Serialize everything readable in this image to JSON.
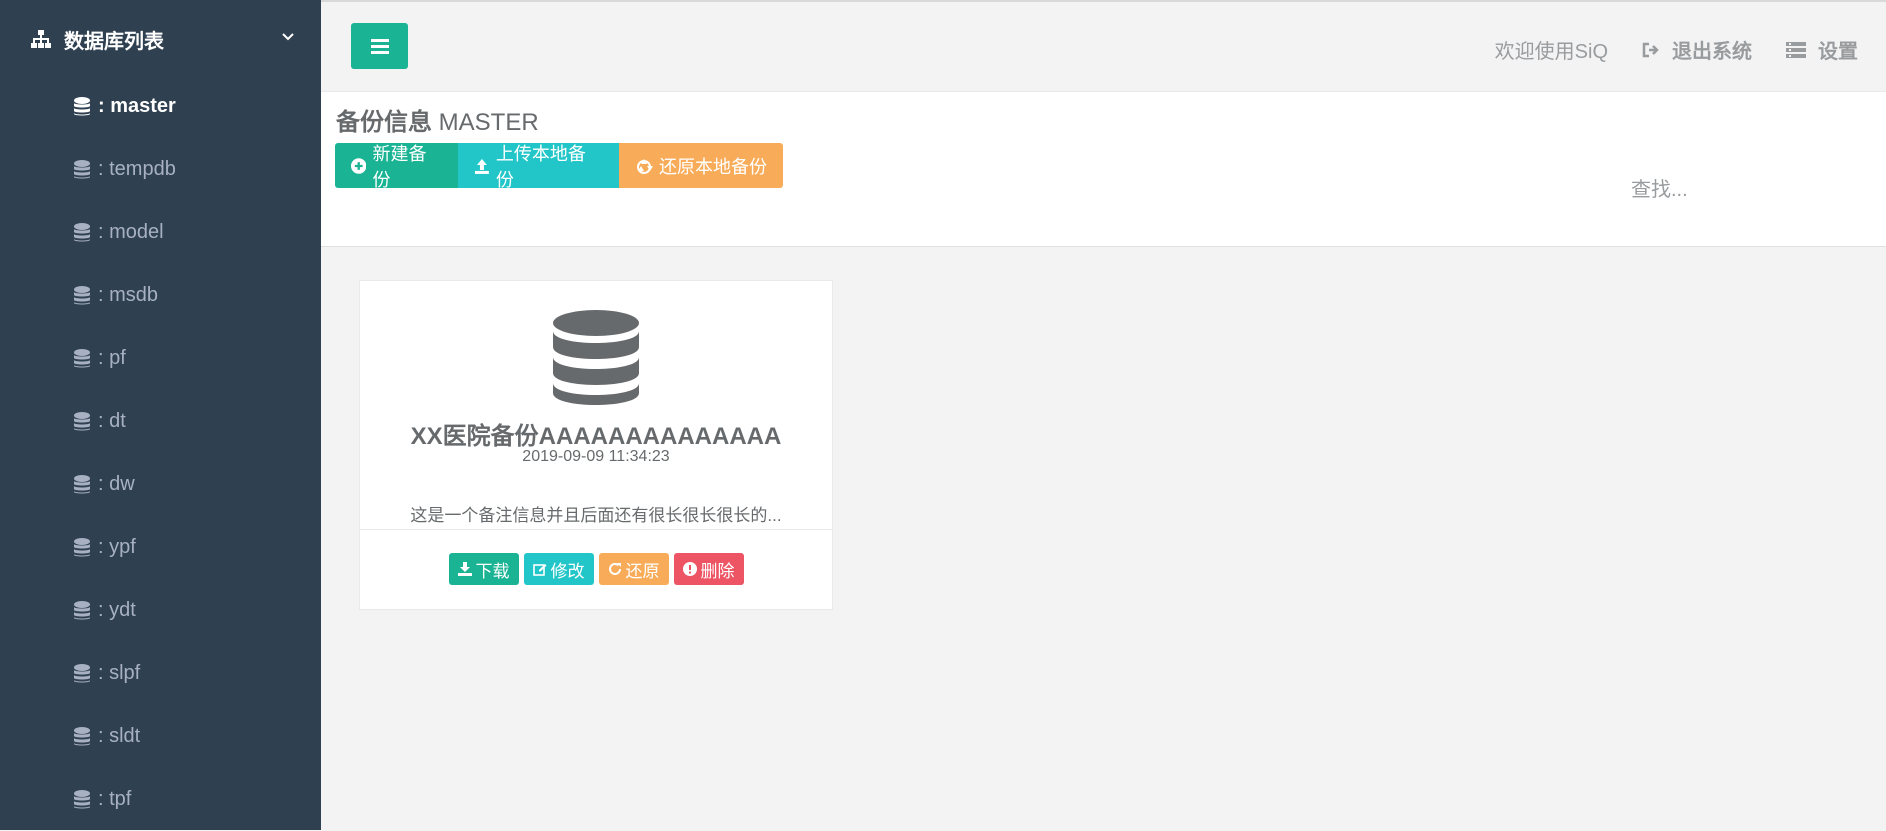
{
  "sidebar": {
    "header": {
      "label": "数据库列表",
      "icon": "sitemap-icon"
    },
    "databases": [
      {
        "label": ": master",
        "active": true
      },
      {
        "label": ": tempdb"
      },
      {
        "label": ": model"
      },
      {
        "label": ": msdb"
      },
      {
        "label": ": pf"
      },
      {
        "label": ": dt"
      },
      {
        "label": ": dw"
      },
      {
        "label": ": ypf"
      },
      {
        "label": ": ydt"
      },
      {
        "label": ": slpf"
      },
      {
        "label": ": sldt"
      },
      {
        "label": ": tpf"
      }
    ]
  },
  "topbar": {
    "welcome": "欢迎使用SiQ",
    "logout_label": "退出系统",
    "settings_label": "设置"
  },
  "page": {
    "title": "备份信息",
    "db_name": "MASTER",
    "buttons": {
      "new_backup": "新建备份",
      "upload_backup": "上传本地备份",
      "restore_local": "还原本地备份"
    },
    "search_placeholder": "查找..."
  },
  "backups": [
    {
      "title": "XX医院备份AAAAAAAAAAAAAA",
      "time": "2019-09-09 11:34:23",
      "note": "这是一个备注信息并且后面还有很长很长很长的...",
      "actions": {
        "download": "下载",
        "edit": "修改",
        "restore": "还原",
        "delete": "删除"
      }
    }
  ],
  "colors": {
    "sidebar_bg": "#2f4050",
    "primary": "#1ab394",
    "info": "#23c6c8",
    "warning": "#f8ac59",
    "danger": "#ed5565"
  }
}
